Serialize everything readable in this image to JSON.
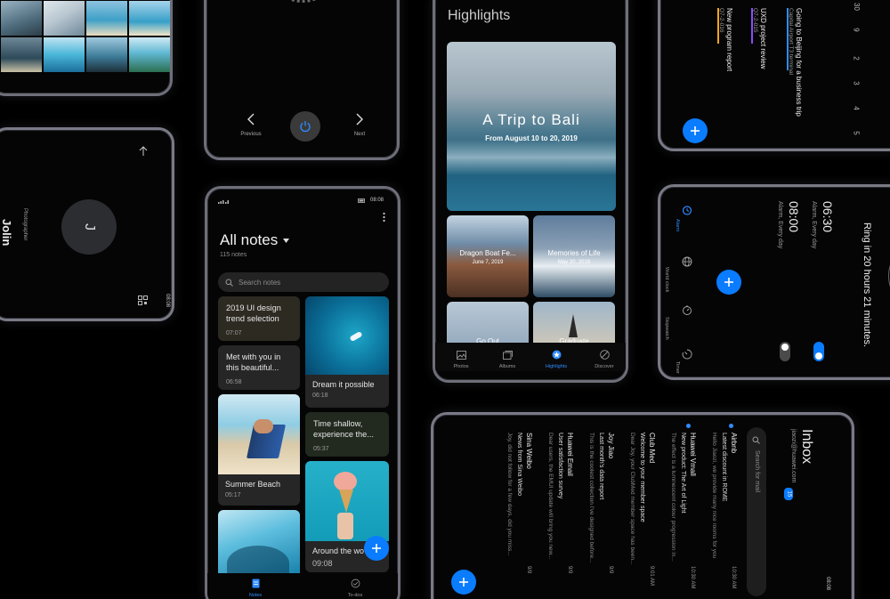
{
  "colors": {
    "accent": "#0a7cff",
    "background": "#000000",
    "card": "#262626"
  },
  "music_player": {
    "previous_label": "Previous",
    "next_label": "Next",
    "icons": [
      "chevron-left-icon",
      "power-icon",
      "chevron-right-icon"
    ]
  },
  "contact": {
    "initial": "J",
    "name": "Jolin",
    "title": "Photographer",
    "time": "08:08"
  },
  "notes": {
    "status_time": "08:08",
    "title": "All notes",
    "count": "115 notes",
    "search_placeholder": "Search notes",
    "cards": [
      {
        "title": "2019 UI design trend selection",
        "date": "07:07"
      },
      {
        "title": "Met with you in this beautiful...",
        "date": "06:58"
      },
      {
        "title": "Summer Beach",
        "date": "05:17"
      },
      {
        "title": "Dream it possible",
        "date": "06:18"
      },
      {
        "title": "Time shallow, experience the...",
        "date": "05:37"
      },
      {
        "title": "Around the wo",
        "date": "09:08"
      }
    ],
    "tabs": [
      {
        "label": "Notes"
      },
      {
        "label": "To-dos"
      }
    ]
  },
  "gallery": {
    "title": "Highlights",
    "hero_title": "A Trip to Bali",
    "hero_subtitle": "From August 10 to 20, 2019",
    "albums": [
      {
        "title": "Dragon Boat Fe...",
        "date": "June 7, 2019"
      },
      {
        "title": "Memories of Life",
        "date": "May 20, 2019"
      },
      {
        "title": "Go Out"
      },
      {
        "title": "Graduate"
      }
    ],
    "tabs": [
      {
        "label": "Photos"
      },
      {
        "label": "Albums"
      },
      {
        "label": "Highlights"
      },
      {
        "label": "Discover"
      }
    ]
  },
  "calendar": {
    "events": [
      {
        "title": "Going to Beijing for a business trip",
        "subtitle": "Capital Airport T3 terminal"
      },
      {
        "title": "UXD project review",
        "subtitle": "Q7-2-015"
      },
      {
        "title": "New program report",
        "subtitle": "Q7-2-016"
      }
    ],
    "column_numbers": [
      "30",
      "9",
      "2",
      "3",
      "4",
      "5"
    ]
  },
  "clock": {
    "alarms": [
      {
        "time": "06:30",
        "repeat": "Alarm, Every day",
        "enabled": true
      },
      {
        "time": "08:00",
        "repeat": "Alarm, Every day",
        "enabled": false
      }
    ],
    "ring_text": "Ring in 20 hours 21 minutes.",
    "tabs": [
      {
        "label": "Alarm"
      },
      {
        "label": "World clock"
      },
      {
        "label": "Stopwatch"
      },
      {
        "label": "Timer"
      }
    ]
  },
  "email": {
    "title": "Inbox",
    "account": "jiaozi@huawei.com",
    "badge": "15",
    "search_placeholder": "Search for mail",
    "time": "08:08",
    "messages": [
      {
        "sender": "Airbnb",
        "subject": "Latest discount in ROME",
        "preview": "Hello Jiaozi, we provide many nice rooms for you",
        "date": "10:30 AM"
      },
      {
        "sender": "Huawei Vmall",
        "subject": "New product: The Art of Light",
        "preview": "The effect is a luminescent colour progression in...",
        "date": "10:30 AM"
      },
      {
        "sender": "Club Med",
        "subject": "Welcome to your member space",
        "preview": "Dear Joy, your ClubMed member space has been...",
        "date": "9:01 AM"
      },
      {
        "sender": "Joy Jiao",
        "subject": "Last month's data report",
        "preview": "This is the coolest collection I've designed before...",
        "date": "9/9"
      },
      {
        "sender": "Huawei Email",
        "subject": "User satisfaction survey",
        "preview": "Dear users, the EMUI update will bring you new...",
        "date": "9/9"
      },
      {
        "sender": "Sina Weibo",
        "subject": "News from Sina Weibo",
        "preview": "Joy, did not follow for a few days, did you miss...",
        "date": "9/9"
      }
    ]
  }
}
